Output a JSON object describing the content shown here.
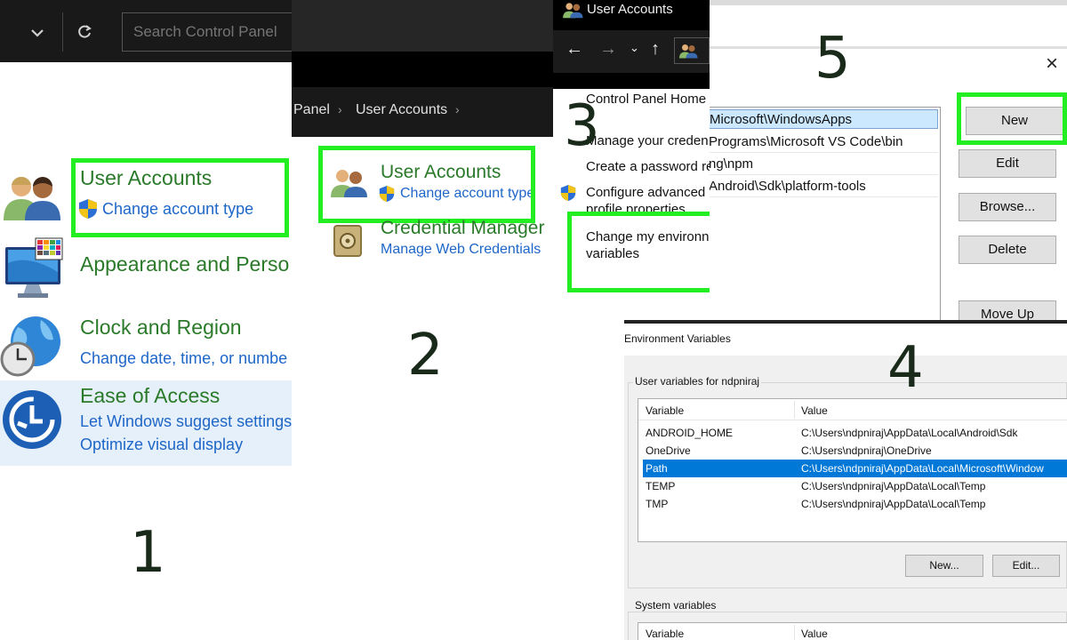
{
  "panel1": {
    "search_placeholder": "Search Control Panel",
    "categories": [
      {
        "title": "User Accounts",
        "links": [
          "Change account type"
        ],
        "icon": "users-icon"
      },
      {
        "title": "Appearance and Perso",
        "links": [],
        "icon": "monitor-icon"
      },
      {
        "title": "Clock and Region",
        "links": [
          "Change date, time, or numbe"
        ],
        "icon": "clock-globe-icon"
      },
      {
        "title": "Ease of Access",
        "links": [
          "Let Windows suggest settings",
          "Optimize visual display"
        ],
        "icon": "ease-of-access-icon"
      }
    ],
    "step_label": "1"
  },
  "panel2": {
    "breadcrumb": [
      "Panel",
      "User Accounts"
    ],
    "items": [
      {
        "title": "User Accounts",
        "link": "Change account type",
        "icon": "users-icon"
      },
      {
        "title": "Credential Manager",
        "link": "Manage Web Credentials",
        "icon": "credential-safe-icon"
      }
    ],
    "step_label": "2"
  },
  "panel3": {
    "window_title": "User Accounts",
    "links": [
      "Control Panel Home",
      "Manage your creden",
      "Create a password re",
      "Configure advanced",
      "profile properties",
      "Change my environn",
      "variables"
    ],
    "step_label": "3"
  },
  "panel5": {
    "path_entries": [
      "Microsoft\\WindowsApps",
      "Programs\\Microsoft VS Code\\bin",
      "ng\\npm",
      "Android\\Sdk\\platform-tools"
    ],
    "buttons": [
      "New",
      "Edit",
      "Browse...",
      "Delete",
      "Move Up"
    ],
    "close_glyph": "×",
    "step_label": "5"
  },
  "panel4": {
    "window_title": "Environment Variables",
    "user_group_label": "User variables for ndpniraj",
    "columns": [
      "Variable",
      "Value"
    ],
    "rows": [
      {
        "variable": "ANDROID_HOME",
        "value": "C:\\Users\\ndpniraj\\AppData\\Local\\Android\\Sdk"
      },
      {
        "variable": "OneDrive",
        "value": "C:\\Users\\ndpniraj\\OneDrive"
      },
      {
        "variable": "Path",
        "value": "C:\\Users\\ndpniraj\\AppData\\Local\\Microsoft\\Window"
      },
      {
        "variable": "TEMP",
        "value": "C:\\Users\\ndpniraj\\AppData\\Local\\Temp"
      },
      {
        "variable": "TMP",
        "value": "C:\\Users\\ndpniraj\\AppData\\Local\\Temp"
      }
    ],
    "selected_row": "Path",
    "buttons": [
      "New...",
      "Edit..."
    ],
    "system_group_label": "System variables",
    "step_label": "4"
  },
  "colors": {
    "highlight": "#22ee22",
    "link": "#1e66c8",
    "category_title": "#2a7a2a",
    "selection": "#0078d7",
    "dark_bar": "#191919"
  }
}
